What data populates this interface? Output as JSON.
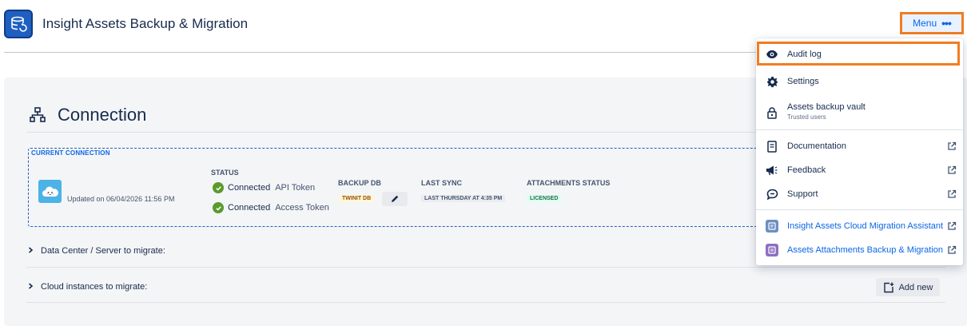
{
  "app": {
    "title": "Insight Assets Backup & Migration",
    "menu_label": "Menu",
    "menu_dots": "•••"
  },
  "connection": {
    "title": "Connection",
    "current_label": "CURRENT CONNECTION",
    "updated_text": "Updated on 06/04/2026 11:56 PM",
    "status_head": "STATUS",
    "statuses": [
      {
        "main": "Connected",
        "sub": "API Token"
      },
      {
        "main": "Connected",
        "sub": "Access Token"
      }
    ],
    "backup_db_head": "BACKUP DB",
    "backup_db_value": "TWINIT DB",
    "last_sync_head": "LAST SYNC",
    "last_sync_value": "LAST THURSDAY AT 4:35 PM",
    "attachments_head": "ATTACHMENTS STATUS",
    "attachments_value": "LICENSED"
  },
  "sections": {
    "datacenter": "Data Center / Server to migrate:",
    "cloud": "Cloud instances to migrate:",
    "add_new": "Add new"
  },
  "menu": {
    "items": [
      {
        "label": "Audit log",
        "icon": "eye-icon"
      },
      {
        "label": "Settings",
        "icon": "gear-icon"
      },
      {
        "label": "Assets backup vault",
        "sub": "Trusted users",
        "icon": "lock-icon"
      },
      {
        "label": "Documentation",
        "icon": "document-icon"
      },
      {
        "label": "Feedback",
        "icon": "megaphone-icon"
      },
      {
        "label": "Support",
        "icon": "chat-icon"
      },
      {
        "label": "Insight Assets Cloud Migration Assistant",
        "icon": "migration-app-icon"
      },
      {
        "label": "Assets Attachments Backup & Migration",
        "icon": "attachments-app-icon"
      }
    ]
  },
  "colors": {
    "highlight": "#f07d22",
    "brand": "#1f5fc0",
    "link": "#0c66e4"
  }
}
